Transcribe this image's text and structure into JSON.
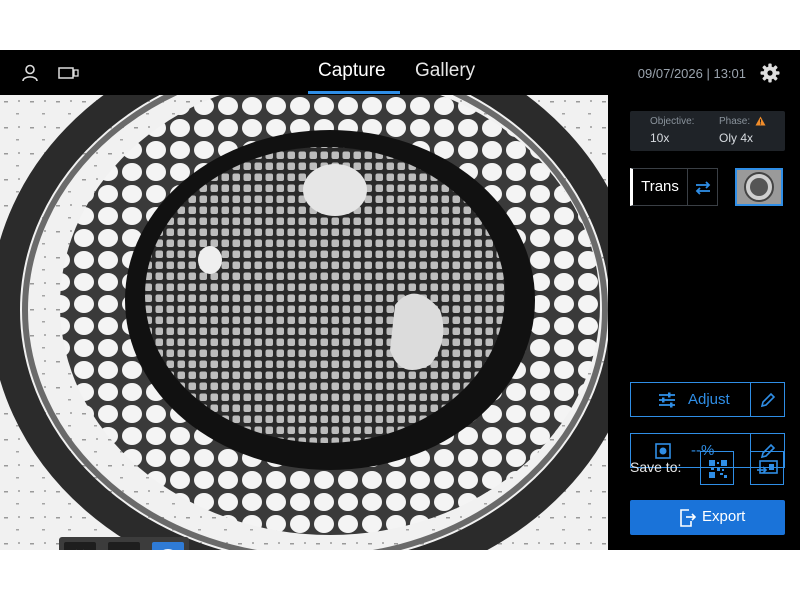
{
  "header": {
    "tabs": [
      {
        "label": "Capture",
        "active": true
      },
      {
        "label": "Gallery",
        "active": false
      }
    ],
    "datetime": "09/07/2026 | 13:01",
    "icons": [
      "user-icon",
      "camera-icon",
      "gear-icon"
    ]
  },
  "panel": {
    "objective_label": "Objective:",
    "objective_value": "10x",
    "phase_label": "Phase:",
    "phase_value": "Oly 4x",
    "mode_label": "Trans",
    "adjust_label": "Adjust",
    "percent_label": "--%",
    "save_to_label": "Save to:",
    "export_label": "Export"
  },
  "toolbar": {
    "tools": [
      "grid-icon",
      "ruler-icon",
      "palette-icon"
    ],
    "active_tool": "palette-icon"
  },
  "colors": {
    "accent": "#2f8ee6",
    "primary_button": "#1a73d9",
    "warning": "#f08c2a",
    "background": "#000000"
  }
}
